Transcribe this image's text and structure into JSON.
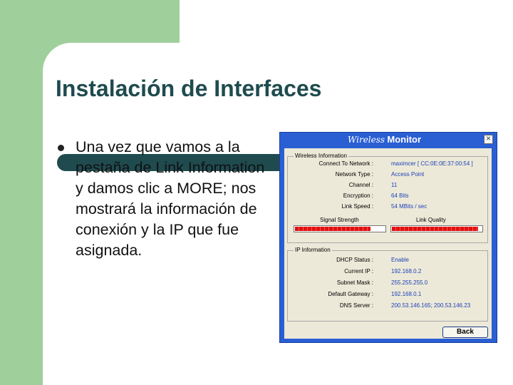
{
  "slide": {
    "title": "Instalación de Interfaces",
    "bullet": "Una vez que vamos a la pestaña de Link Information y damos clic a MORE; nos mostrará la información de conexión y la IP que fue asignada."
  },
  "dialog": {
    "title_italic": "Wireless",
    "title_bold": "Monitor",
    "close_glyph": "×",
    "wireless_group": "Wireless Information",
    "wireless_rows": [
      {
        "label": "Connect To Network :",
        "value": "maximcer [ CC:0E:0E:37:00:54 ]"
      },
      {
        "label": "Network Type :",
        "value": "Access Point"
      },
      {
        "label": "Channel :",
        "value": "11"
      },
      {
        "label": "Encryption :",
        "value": "64 Bits"
      },
      {
        "label": "Link Speed :",
        "value": "54 MBits / sec"
      }
    ],
    "signal_strength_label": "Signal Strength",
    "link_quality_label": "Link Quality",
    "signal_strength_level": 0.84,
    "link_quality_level": 0.96,
    "ip_group": "IP Information",
    "ip_rows": [
      {
        "label": "DHCP Status :",
        "value": "Enable"
      },
      {
        "label": "Current IP :",
        "value": "192.168.0.2"
      },
      {
        "label": "Subnet Mask :",
        "value": "255.255.255.0"
      },
      {
        "label": "Default Gateway :",
        "value": "192.168.0.1"
      },
      {
        "label": "DNS Server :",
        "value": "200.53.146.165; 200.53.146.23"
      }
    ],
    "back_label": "Back"
  },
  "colors": {
    "accent_green": "#9fcf9b",
    "title_teal": "#1f4b4f",
    "dialog_blue": "#2a5fd4",
    "value_blue": "#1c3fb8",
    "bar_red": "#e01010"
  }
}
